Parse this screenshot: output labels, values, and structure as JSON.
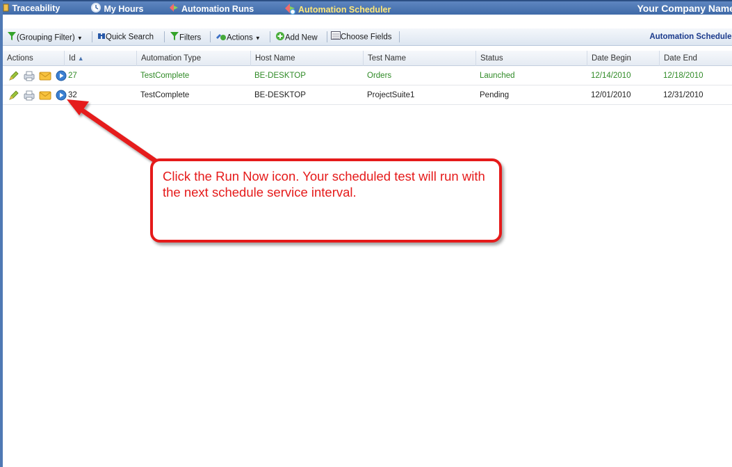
{
  "nav": {
    "items": [
      {
        "label": "Traceability",
        "icon": "traceability-icon"
      },
      {
        "label": "My Hours",
        "icon": "clock-icon"
      },
      {
        "label": "Automation Runs",
        "icon": "automation-runs-icon"
      },
      {
        "label": "Automation Scheduler",
        "icon": "scheduler-icon",
        "active": true
      }
    ],
    "company": "Your Company Name"
  },
  "toolbar": {
    "grouping_filter": "(Grouping Filter)",
    "quick_search": "Quick Search",
    "filters": "Filters",
    "actions": "Actions",
    "add_new": "Add New",
    "choose_fields": "Choose Fields",
    "page_label": "Automation Scheduler"
  },
  "grid": {
    "columns": [
      "Actions",
      "Id",
      "Automation Type",
      "Host Name",
      "Test Name",
      "Status",
      "Date Begin",
      "Date End"
    ],
    "sort_indicator": "▲",
    "rows": [
      {
        "id": "27",
        "automation_type": "TestComplete",
        "host_name": "BE-DESKTOP",
        "test_name": "Orders",
        "status": "Launched",
        "date_begin": "12/14/2010",
        "date_end": "12/18/2010"
      },
      {
        "id": "32",
        "automation_type": "TestComplete",
        "host_name": "BE-DESKTOP",
        "test_name": "ProjectSuite1",
        "status": "Pending",
        "date_begin": "12/01/2010",
        "date_end": "12/31/2010"
      }
    ],
    "row_action_icons": [
      "edit-icon",
      "print-icon",
      "email-icon",
      "run-now-icon"
    ]
  },
  "callout": {
    "text": "Click the Run Now icon. Your scheduled test will run with the next schedule service interval."
  },
  "colors": {
    "nav_bg": "#4a74b0",
    "active_nav": "#ffe87a",
    "launched_text": "#2f8a26",
    "callout_red": "#e51a1a"
  }
}
